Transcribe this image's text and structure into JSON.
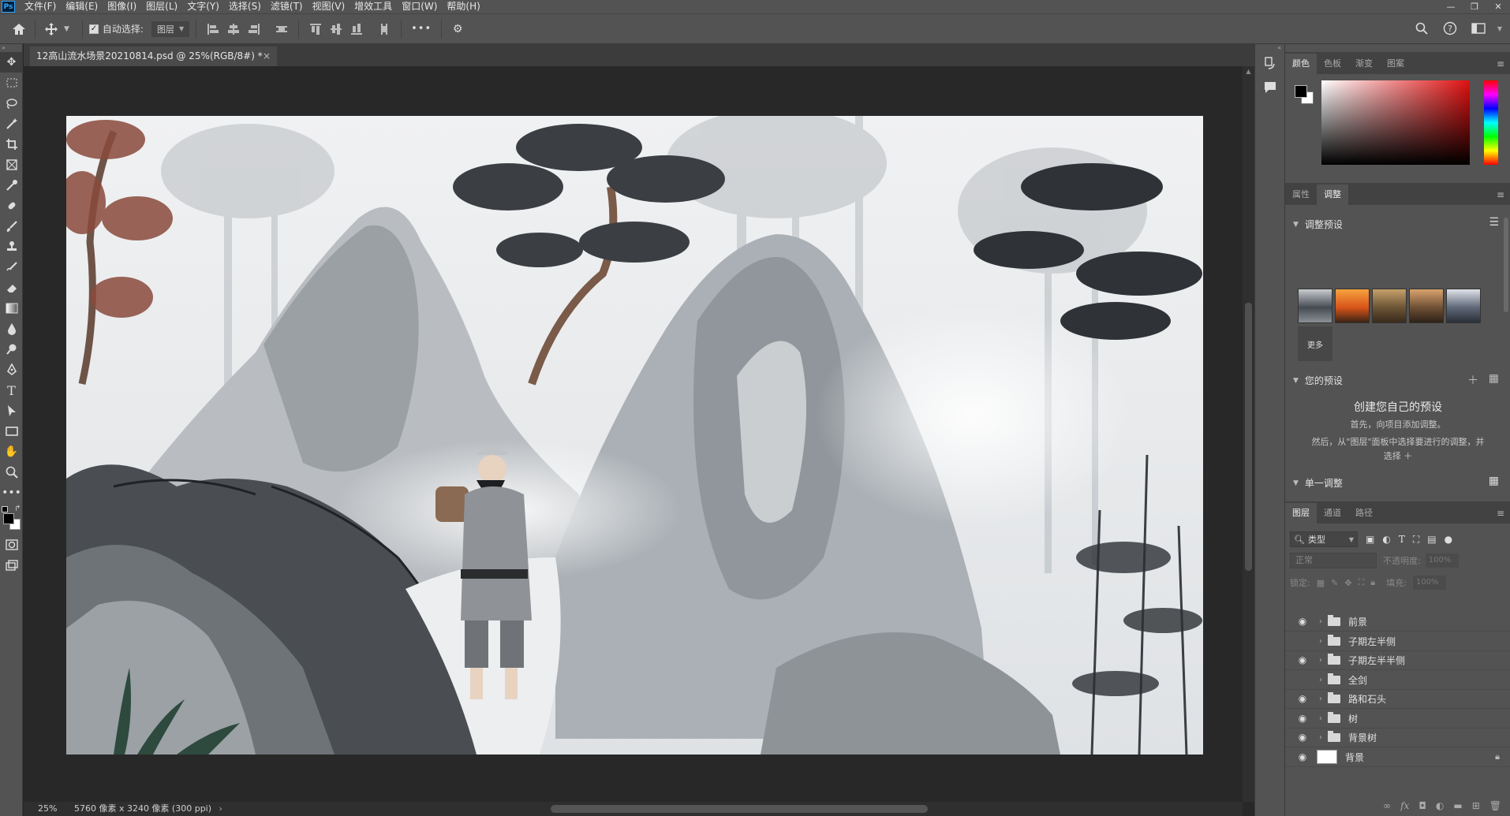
{
  "app": {
    "logo": "Ps"
  },
  "menu": [
    "文件(F)",
    "编辑(E)",
    "图像(I)",
    "图层(L)",
    "文字(Y)",
    "选择(S)",
    "滤镜(T)",
    "视图(V)",
    "增效工具",
    "窗口(W)",
    "帮助(H)"
  ],
  "window_controls": [
    "—",
    "❐",
    "✕"
  ],
  "options": {
    "auto_select_label": "自动选择:",
    "auto_select_target": "图层",
    "more": "•••"
  },
  "document": {
    "tab_title": "12高山流水场景20210814.psd @ 25%(RGB/8#) *",
    "close": "×",
    "zoom": "25%",
    "info": "5760 像素 x 3240 像素 (300 ppi)"
  },
  "color_panel": {
    "tabs": [
      "颜色",
      "色板",
      "渐变",
      "图案"
    ],
    "accent": "#e01010"
  },
  "adjust_panel": {
    "tabs": [
      "属性",
      "调整"
    ],
    "presets_title": "调整预设",
    "more_label": "更多",
    "your_presets_title": "您的预设",
    "create_title": "创建您自己的预设",
    "hint1": "首先，向项目添加调整。",
    "hint2": "然后，从\"图层\"面板中选择要进行的调整，并",
    "hint3": "选择 ＋",
    "single_title": "单一调整"
  },
  "layers_panel": {
    "tabs": [
      "图层",
      "通道",
      "路径"
    ],
    "filter": "类型",
    "blend_mode": "正常",
    "opacity_label": "不透明度:",
    "opacity_value": "100%",
    "lock_label": "锁定:",
    "fill_label": "填充:",
    "fill_value": "100%",
    "layers": [
      {
        "name": "前景",
        "visible": true,
        "type": "group"
      },
      {
        "name": "子期左半侧",
        "visible": false,
        "type": "group"
      },
      {
        "name": "子期左半半侧",
        "visible": true,
        "type": "group"
      },
      {
        "name": "全剑",
        "visible": false,
        "type": "group"
      },
      {
        "name": "路和石头",
        "visible": true,
        "type": "group"
      },
      {
        "name": "树",
        "visible": true,
        "type": "group"
      },
      {
        "name": "背景树",
        "visible": true,
        "type": "group"
      },
      {
        "name": "背景",
        "visible": true,
        "type": "pixel",
        "locked": true
      }
    ]
  }
}
